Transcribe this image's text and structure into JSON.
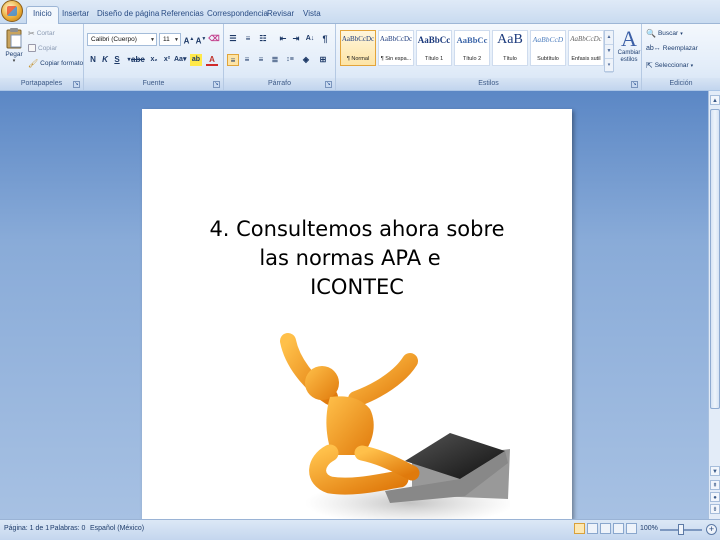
{
  "tabs": [
    "Inicio",
    "Insertar",
    "Diseño de página",
    "Referencias",
    "Correspondencia",
    "Revisar",
    "Vista"
  ],
  "ribbon": {
    "clipboard": {
      "paste": "Pegar",
      "cut": "Cortar",
      "copy": "Copiar",
      "format_painter": "Copiar formato",
      "label": "Portapapeles"
    },
    "font": {
      "font_name": "Calibri (Cuerpo)",
      "font_size": "11",
      "label": "Fuente"
    },
    "paragraph": {
      "label": "Párrafo"
    },
    "styles": {
      "label": "Estilos",
      "tiles": [
        {
          "sample": "AaBbCcDc",
          "name": "¶ Normal"
        },
        {
          "sample": "AaBbCcDc",
          "name": "¶ Sin espa..."
        },
        {
          "sample": "AaBbCc",
          "name": "Título 1"
        },
        {
          "sample": "AaBbCc",
          "name": "Título 2"
        },
        {
          "sample": "AaB",
          "name": "Título"
        },
        {
          "sample": "AaBbCcD",
          "name": "Subtítulo"
        },
        {
          "sample": "AaBbCcDc",
          "name": "Énfasis sutil"
        }
      ],
      "change_styles": "Cambiar estilos"
    },
    "editing": {
      "find": "Buscar",
      "replace": "Reemplazar",
      "select": "Seleccionar",
      "label": "Edición"
    }
  },
  "document": {
    "lines": [
      "4. Consultemos ahora sobre",
      "las normas APA e",
      "ICONTEC"
    ]
  },
  "statusbar": {
    "page": "Página: 1 de 1",
    "words": "Palabras: 0",
    "language": "Español (México)",
    "zoom": "100%"
  },
  "colors": {
    "ribbon_text": "#15428b",
    "figure_orange": "#f29a1f",
    "doc_background": "#6f96cf"
  }
}
